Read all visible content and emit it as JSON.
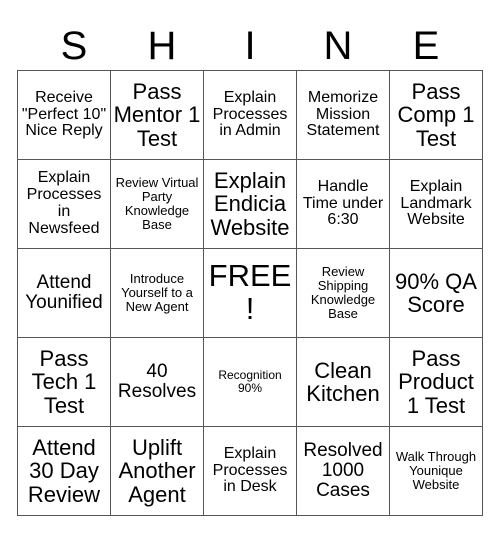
{
  "card": {
    "title_letters": [
      "S",
      "H",
      "I",
      "N",
      "E"
    ],
    "rows": [
      [
        {
          "text": "Receive \"Perfect 10\" Nice Reply",
          "size": "sm",
          "free": false
        },
        {
          "text": "Pass Mentor 1 Test",
          "size": "lg",
          "free": false
        },
        {
          "text": "Explain Processes in Admin",
          "size": "sm",
          "free": false
        },
        {
          "text": "Memorize Mission Statement",
          "size": "sm",
          "free": false
        },
        {
          "text": "Pass Comp 1 Test",
          "size": "lg",
          "free": false
        }
      ],
      [
        {
          "text": "Explain Processes in Newsfeed",
          "size": "sm",
          "free": false
        },
        {
          "text": "Review Virtual Party Knowledge Base",
          "size": "xs",
          "free": false
        },
        {
          "text": "Explain Endicia Website",
          "size": "lg",
          "free": false
        },
        {
          "text": "Handle Time under 6:30",
          "size": "sm",
          "free": false
        },
        {
          "text": "Explain Landmark Website",
          "size": "sm",
          "free": false
        }
      ],
      [
        {
          "text": "Attend Younified",
          "size": "md",
          "free": false
        },
        {
          "text": "Introduce Yourself to a New Agent",
          "size": "xs",
          "free": false
        },
        {
          "text": "FREE!",
          "size": "xl",
          "free": true
        },
        {
          "text": "Review Shipping Knowledge Base",
          "size": "xs",
          "free": false
        },
        {
          "text": "90% QA Score",
          "size": "lg",
          "free": false
        }
      ],
      [
        {
          "text": "Pass Tech 1 Test",
          "size": "lg",
          "free": false
        },
        {
          "text": "40 Resolves",
          "size": "md",
          "free": false
        },
        {
          "text": "Recognition 90%",
          "size": "xxs",
          "free": false
        },
        {
          "text": "Clean Kitchen",
          "size": "lg",
          "free": false
        },
        {
          "text": "Pass Product 1 Test",
          "size": "lg",
          "free": false
        }
      ],
      [
        {
          "text": "Attend 30 Day Review",
          "size": "lg",
          "free": false
        },
        {
          "text": "Uplift Another Agent",
          "size": "lg",
          "free": false
        },
        {
          "text": "Explain Processes in Desk",
          "size": "sm",
          "free": false
        },
        {
          "text": "Resolved 1000 Cases",
          "size": "md",
          "free": false
        },
        {
          "text": "Walk Through Younique Website",
          "size": "xs",
          "free": false
        }
      ]
    ],
    "colors": {
      "background": "#ffffff",
      "text": "#000000",
      "border": "#555555"
    }
  }
}
